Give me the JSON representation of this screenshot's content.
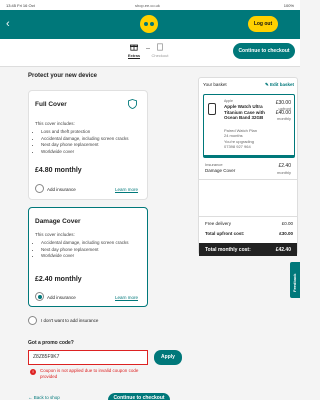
{
  "statusbar": {
    "time": "13:45",
    "date": "Fri 16 Oct",
    "url": "shop.ee.co.uk",
    "battery": "100%"
  },
  "header": {
    "logout_label": "Log out"
  },
  "steps": [
    {
      "label": "Extras"
    },
    {
      "label": "Checkout"
    }
  ],
  "continue_label": "Continue to checkout",
  "section_title": "Protect your new device",
  "full_cover": {
    "name": "Full Cover",
    "covers_title": "This cover includes:",
    "items": [
      "Loss and theft protection",
      "Accidental damage, including screen cracks",
      "Next day phone replacement",
      "Worldwide cover"
    ],
    "price": "£4.80 monthly",
    "add_label": "Add insurance",
    "learn_more": "Learn more"
  },
  "damage_cover": {
    "name": "Damage Cover",
    "covers_title": "This cover includes:",
    "items": [
      "Accidental damage, including screen cracks",
      "Next day phone replacement",
      "Worldwide cover"
    ],
    "price": "£2.40 monthly",
    "add_label": "Add insurance",
    "learn_more": "Learn more"
  },
  "no_insurance_label": "I don't want to add insurance",
  "promo": {
    "label": "Got a promo code?",
    "value": "Z8Z85F9K7",
    "apply_label": "Apply",
    "error": "Coupon is not applied due to invalid coupon code provided"
  },
  "back_to_shop": "← Back to shop",
  "basket": {
    "title": "Your basket",
    "edit_label": "✎ Edit basket",
    "item": {
      "brand": "Apple",
      "name": "Apple Watch Ultra Titanium Case with Ocean Band 32GB",
      "plan_line1": "Paired Watch Plan",
      "plan_line2": "24 months",
      "upgrade_line1": "You're upgrading",
      "upgrade_line2": "07398 927 964",
      "upfront": "£30.00",
      "upfront_label": "upfront",
      "monthly": "£40.00",
      "monthly_label": "monthly"
    },
    "insurance_label": "Insurance",
    "insurance_name": "Damage Cover",
    "insurance_price": "£2.40",
    "insurance_price_label": "monthly",
    "delivery_label": "Free delivery",
    "delivery_value": "£0.00",
    "upfront_total_label": "Total upfront cost:",
    "upfront_total_value": "£30.00",
    "monthly_total_label": "Total monthly cost:",
    "monthly_total_value": "£42.40"
  },
  "feedback_label": "Feedback",
  "colors": {
    "brand": "#00787a",
    "accent": "#ffd100",
    "error": "#d22222"
  }
}
